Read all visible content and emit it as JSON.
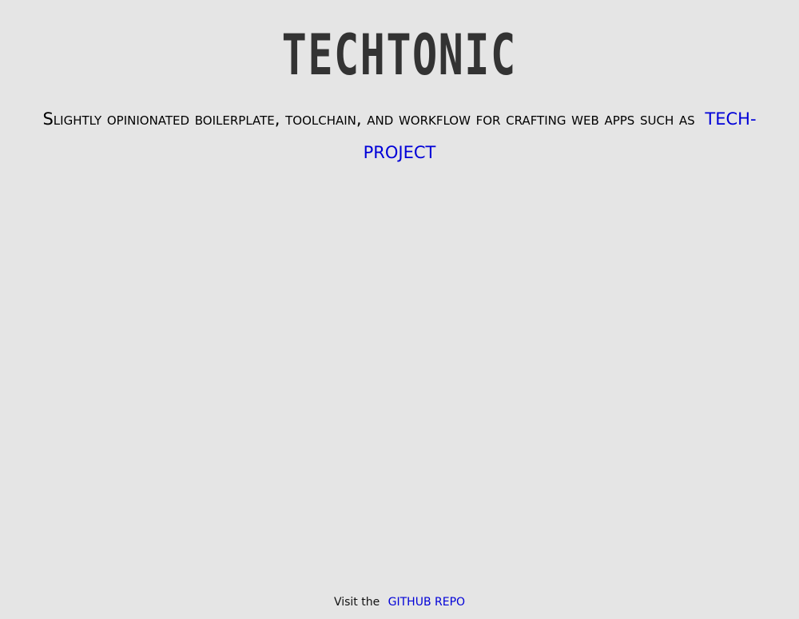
{
  "logo": {
    "text": "TECHTONIC"
  },
  "tagline": {
    "text": "Slightly opinionated boilerplate, toolchain, and workflow for crafting web apps such as",
    "link_label": "TECH-PROJECT"
  },
  "footer": {
    "prefix": "Visit the",
    "link_label": "GITHUB REPO"
  },
  "colors": {
    "background": "#e5e5e5",
    "logo": "#333333",
    "link": "#0000d8",
    "text": "#000000"
  }
}
